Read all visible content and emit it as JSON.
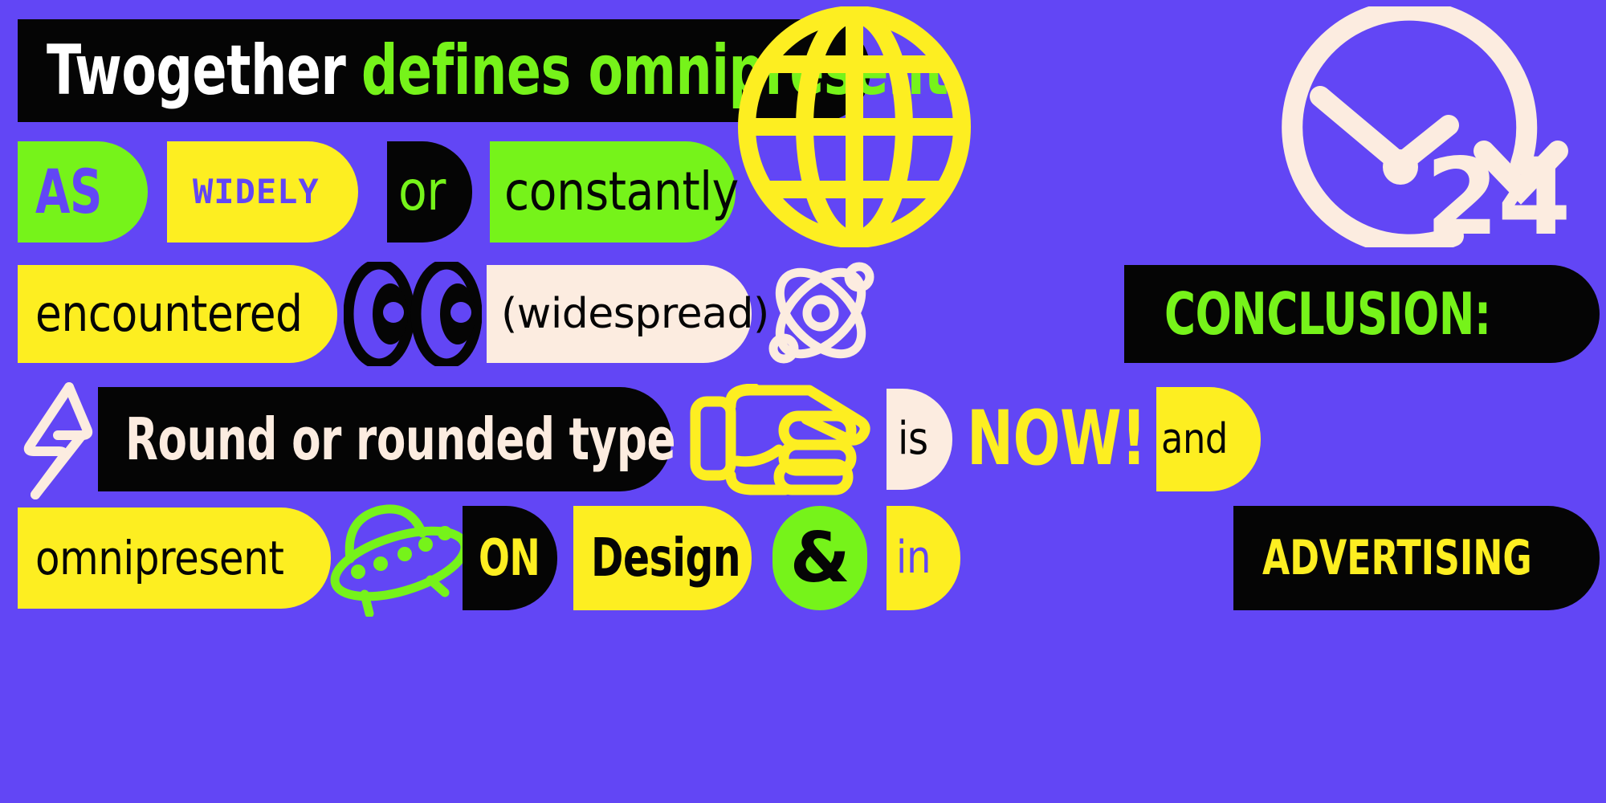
{
  "poster": {
    "background_color": "#6246f5",
    "palette": {
      "purple": "#6246f5",
      "yellow": "#fdee21",
      "green": "#76f31a",
      "black": "#050505",
      "cream": "#fcece0",
      "white": "#ffffff"
    }
  },
  "rows": {
    "row1": {
      "headline_word1": "Twogether",
      "headline_word2": "defines omnipresent",
      "globe_icon": "globe-icon",
      "clock_icon": "clock-arrow-icon",
      "clock_number": "24"
    },
    "row2": {
      "as": "AS",
      "widely": "WIDELY",
      "or": "or",
      "constantly": "constantly"
    },
    "row3": {
      "encountered": "encountered",
      "eyes_icon": "eyes-icon",
      "widespread": "(widespread)",
      "atom_icon": "atom-icon",
      "conclusion": "CONCLUSION:"
    },
    "row4": {
      "bolt_icon": "lightning-bolt-icon",
      "round_type": "Round or rounded type",
      "hand_icon": "pointing-hand-icon",
      "is": "is",
      "now": "NOW!",
      "and": "and"
    },
    "row5": {
      "omnipresent": "omnipresent",
      "ufo_icon": "ufo-icon",
      "on": "ON",
      "design": "Design",
      "ampersand": "&",
      "in": "in",
      "advertising": "ADVERTISING"
    }
  }
}
